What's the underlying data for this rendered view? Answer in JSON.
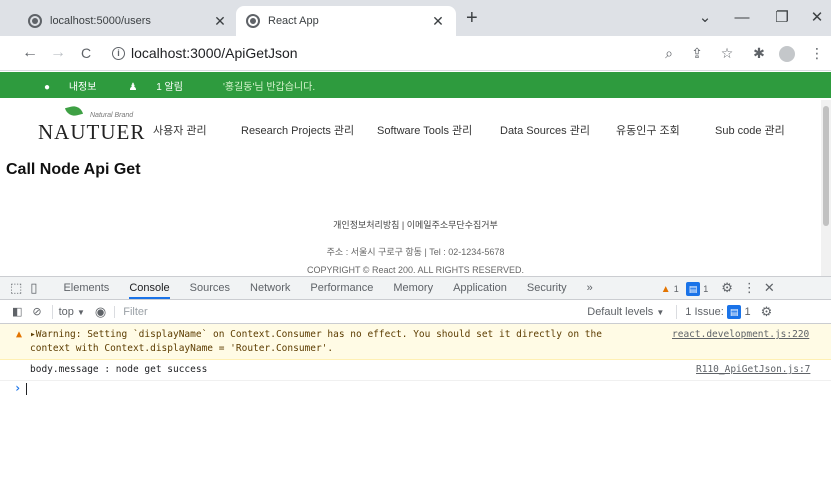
{
  "tabs": [
    {
      "title": "localhost:5000/users",
      "active": false
    },
    {
      "title": "React App",
      "active": true
    }
  ],
  "window": {
    "new_tab": "+",
    "chevron": "⌄",
    "minimize": "—",
    "restore": "❐",
    "close": "✕"
  },
  "toolbar": {
    "back": "←",
    "forward": "→",
    "reload": "C",
    "url": "localhost:3000/ApiGetJson"
  },
  "site": {
    "greenbar": {
      "profile": "내정보",
      "alerts": "1 알림",
      "welcome": "'홍길동'님 반갑습니다."
    },
    "logo": {
      "word": "NAUTUER",
      "brand": "Natural Brand"
    },
    "nav": [
      "사용자 관리",
      "Research Projects 관리",
      "Software Tools 관리",
      "Data Sources 관리",
      "유동인구 조회",
      "Sub code 관리"
    ],
    "page_title": "Call Node Api Get",
    "footer": {
      "links": "개인정보처리방침  |  이메일주소무단수집거부",
      "address": "주소 : 서울시 구로구 항동  | Tel : 02-1234-5678",
      "copyright": "COPYRIGHT © React 200. ALL RIGHTS RESERVED."
    }
  },
  "devtools": {
    "tabs": [
      "Elements",
      "Console",
      "Sources",
      "Network",
      "Performance",
      "Memory",
      "Application",
      "Security",
      "»"
    ],
    "active_tab": "Console",
    "warning_count": "1",
    "message_count": "1",
    "context": "top",
    "filter_placeholder": "Filter",
    "levels": "Default levels",
    "issues_label": "1 Issue:",
    "issues_count": "1",
    "messages": [
      {
        "level": "warning",
        "line1": "▸Warning: Setting `displayName` on Context.Consumer has no effect. You should set it directly on the",
        "line2": "context with Context.displayName = 'Router.Consumer'.",
        "source": "react.development.js:220"
      },
      {
        "level": "log",
        "line1": "body.message : node get success",
        "source": "R110_ApiGetJson.js:7"
      }
    ],
    "prompt": "›"
  },
  "colors": {
    "green_bar": "#2e9b3e",
    "warning_bg": "#fffbe5",
    "accent": "#1a73e8"
  }
}
